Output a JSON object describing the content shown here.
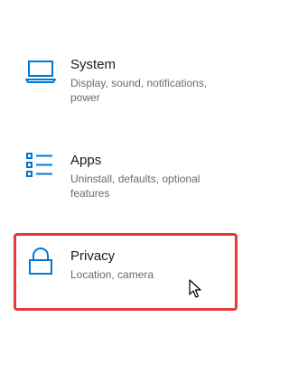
{
  "tiles": [
    {
      "title": "System",
      "desc": "Display, sound, notifications, power",
      "icon": "laptop-icon"
    },
    {
      "title": "Apps",
      "desc": "Uninstall, defaults, optional features",
      "icon": "apps-list-icon"
    },
    {
      "title": "Privacy",
      "desc": "Location, camera",
      "icon": "lock-icon"
    }
  ],
  "colors": {
    "accent": "#0078d7",
    "highlight": "#e5393a",
    "title_text": "#1a1a1a",
    "desc_text": "#6b6b6b"
  },
  "cursor": "pointer-cursor-icon"
}
